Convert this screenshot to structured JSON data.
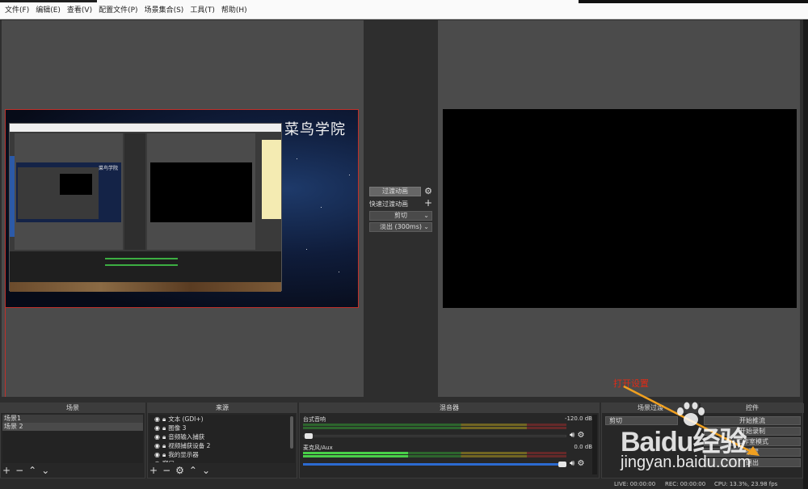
{
  "menu": [
    "文件(F)",
    "编辑(E)",
    "查看(V)",
    "配置文件(P)",
    "场景集合(S)",
    "工具(T)",
    "帮助(H)"
  ],
  "preview": {
    "overlay_title": "菜鸟学院"
  },
  "transition": {
    "button_label": "过渡动画",
    "quick_label": "快速过渡动画",
    "type": "剪切",
    "fade": "淡出 (300ms)"
  },
  "scenes": {
    "title": "场景",
    "items": [
      "场景1",
      "场景 2"
    ]
  },
  "sources": {
    "title": "来源",
    "items": [
      "文本 (GDI+)",
      "图像 3",
      "音频输入捕获",
      "视频捕获设备 2",
      "我的显示器",
      "窗口"
    ]
  },
  "mixer": {
    "title": "混音器",
    "channels": [
      {
        "name": "台式音响",
        "db": "-120.0 dB",
        "level": 0.0
      },
      {
        "name": "麦克风/Aux",
        "db": "0.0 dB",
        "level": 0.95
      }
    ],
    "ticks": [
      "-60",
      "-55",
      "-50",
      "-45",
      "-40",
      "-35",
      "-30",
      "-25",
      "-20",
      "-15",
      "-10",
      "-5",
      "0"
    ]
  },
  "scene_transition": {
    "title": "场景过渡",
    "value": "剪切"
  },
  "controls": {
    "title": "控件",
    "buttons": [
      "开始推流",
      "开始录制",
      "工作室模式",
      "设置",
      "退出"
    ]
  },
  "annotation": "打开设置",
  "status": {
    "live": "LIVE: 00:00:00",
    "rec": "REC: 00:00:00",
    "cpu": "CPU: 13.3%, 23.98 fps"
  },
  "watermark": {
    "logo": "Baidu经验",
    "url": "jingyan.baidu.com"
  },
  "colors": {
    "accent_red": "#e02b16",
    "annotation_arrow": "#f0a020",
    "meter_green": "#49d049",
    "slider_blue": "#2c6ad0"
  }
}
